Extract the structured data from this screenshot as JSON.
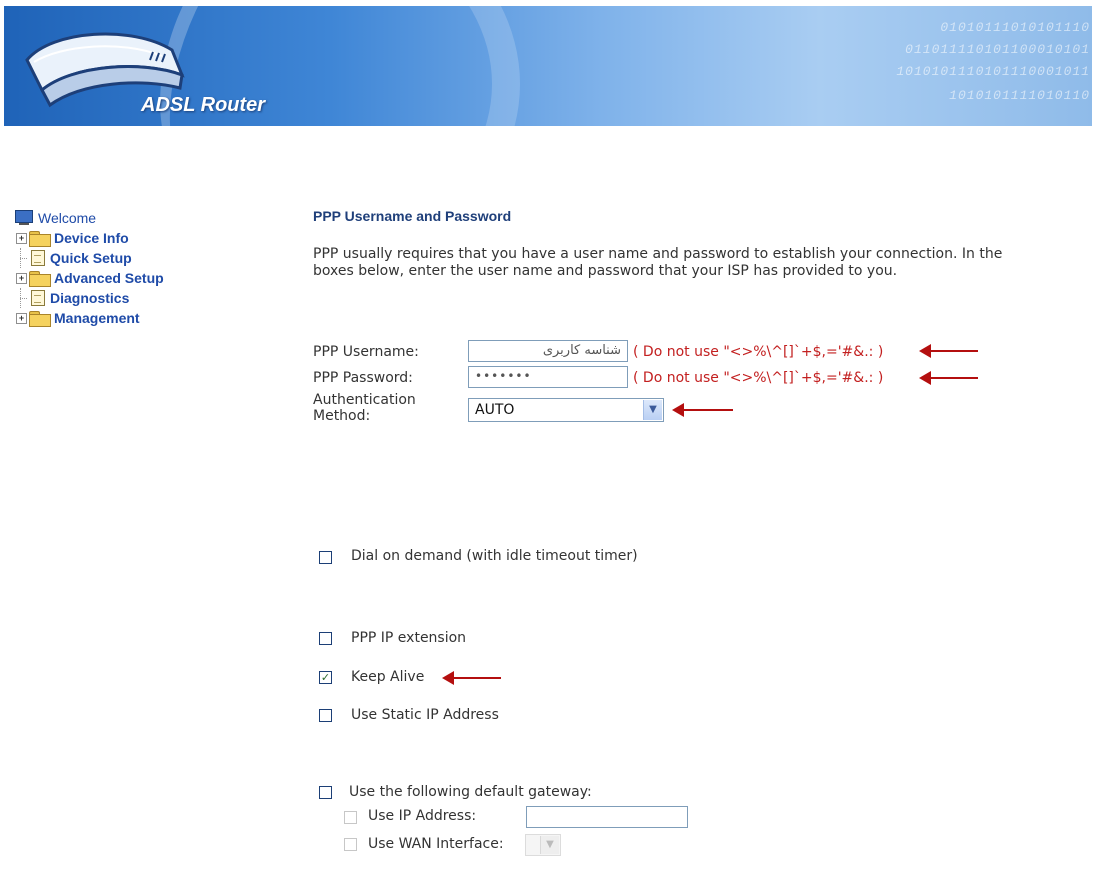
{
  "header": {
    "title": "ADSL Router",
    "binary_lines": [
      "01010111010101110",
      "011011110101100010101",
      "1010101110101110001011",
      "1010101111010110"
    ]
  },
  "sidebar": {
    "root_label": "Welcome",
    "items": [
      {
        "label": "Device Info",
        "type": "folder",
        "expandable": true
      },
      {
        "label": "Quick Setup",
        "type": "page",
        "expandable": false
      },
      {
        "label": "Advanced Setup",
        "type": "folder",
        "expandable": true
      },
      {
        "label": "Diagnostics",
        "type": "page",
        "expandable": false
      },
      {
        "label": "Management",
        "type": "folder",
        "expandable": true
      }
    ],
    "expand_symbol": "+"
  },
  "main": {
    "title": "PPP Username and Password",
    "description": "PPP usually requires that you have a user name and password to establish your connection. In the boxes below, enter the user name and password that your ISP has provided to you.",
    "username_label": "PPP Username:",
    "username_value": "شناسه کاربری",
    "password_label": "PPP Password:",
    "password_value": "•••••••",
    "warning": "( Do not use \"<>%\\^[]`+$,='#&.: )",
    "auth_label_1": "Authentication",
    "auth_label_2": "Method:",
    "auth_value": "AUTO",
    "dial_on_demand": "Dial on demand (with idle timeout timer)",
    "ppp_ip_extension": "PPP IP extension",
    "keep_alive": "Keep Alive",
    "static_ip": "Use Static IP Address",
    "default_gateway": "Use the following default gateway:",
    "use_ip_address": "Use IP Address:",
    "use_wan_interface": "Use WAN Interface:",
    "check_mark": "✓",
    "dropdown_glyph": "▼"
  },
  "colors": {
    "accent_red": "#c32020",
    "arrow_red": "#b40f0f",
    "link_blue": "#1f4ba8",
    "title_navy": "#1f3f7a"
  }
}
